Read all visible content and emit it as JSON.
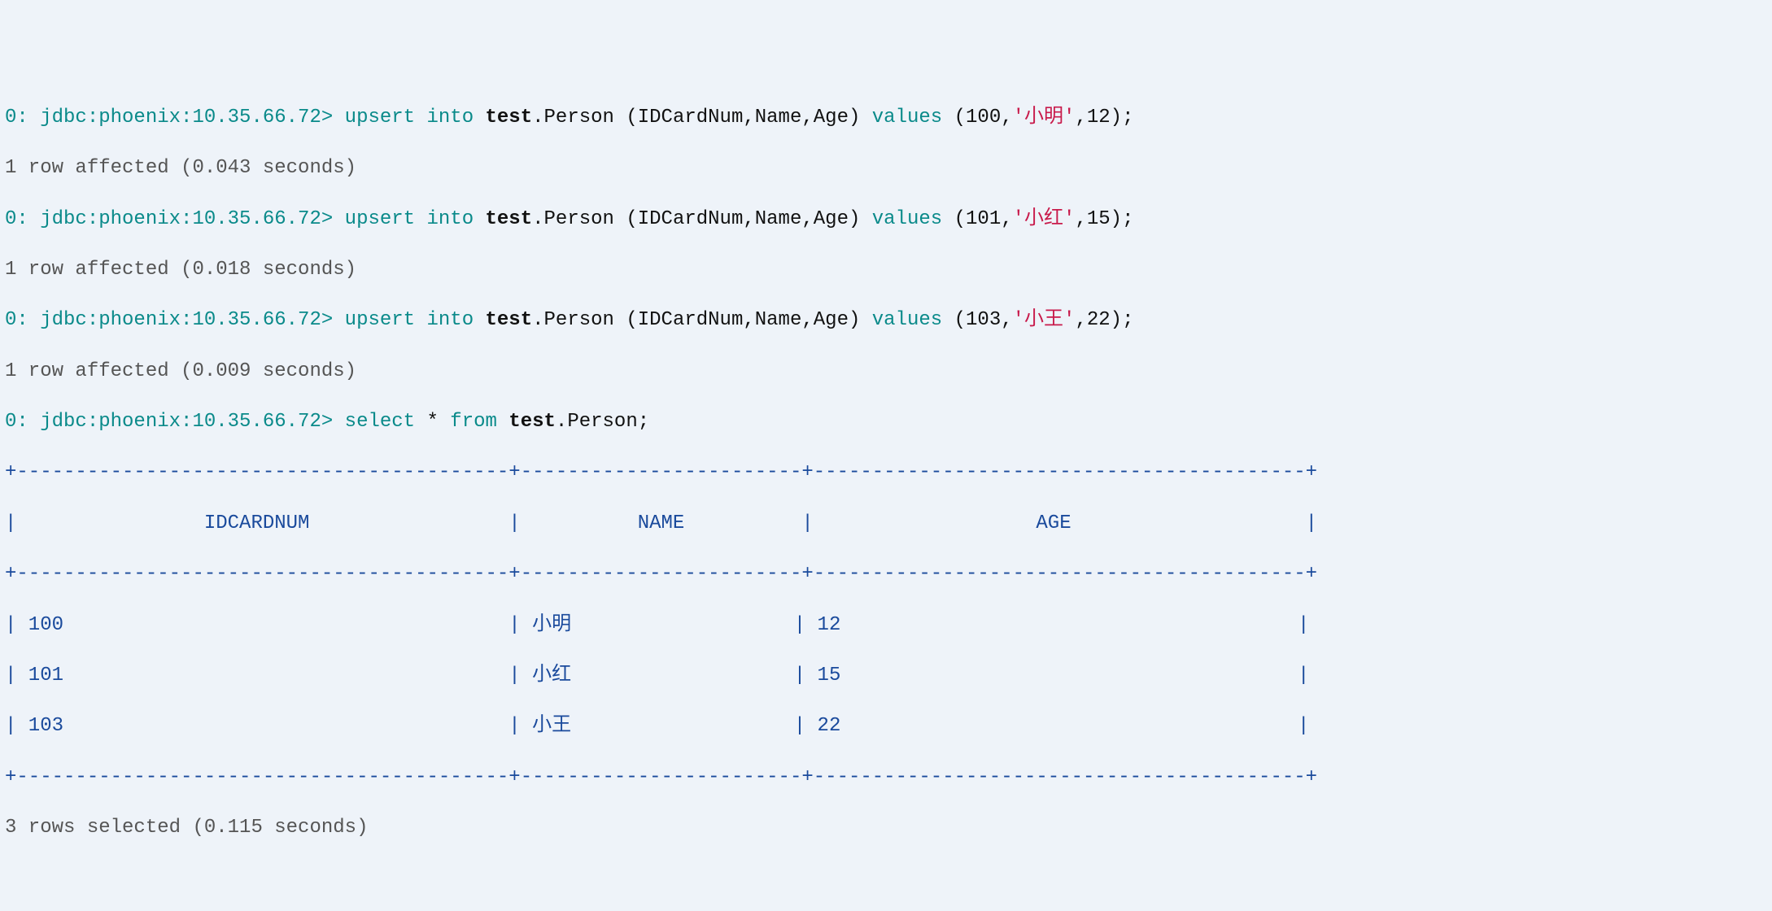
{
  "prompt": "0: jdbc:phoenix:10.35.66.72>",
  "upsert_kw": " upsert into ",
  "test_bold": "test",
  "person_tail1": ".Person (IDCardNum,Name,Age) ",
  "values_kw": "values",
  "paren_open": " (",
  "comma": ",",
  "close_paren_semi": ");",
  "affected1": "1 row affected (0.043 seconds)",
  "affected2": "1 row affected (0.018 seconds)",
  "affected3": "1 row affected (0.009 seconds)",
  "select_kw": " select ",
  "star": "*",
  "from_kw": " from ",
  "select_tail": ".Person;",
  "row1": {
    "id": "100",
    "name": "'小明'",
    "age": "12"
  },
  "row2": {
    "id": "101",
    "name": "'小红'",
    "age": "15"
  },
  "row3": {
    "id": "103",
    "name": "'小王'",
    "age": "22"
  },
  "values_tail1": ",12",
  "values_tail2": ",15",
  "values_tail3": ",22",
  "table": {
    "border": "+------------------------------------------+------------------------+------------------------------------------+",
    "header": "|                IDCARDNUM                 |          NAME          |                   AGE                    |",
    "r1": "| 100                                      | 小明                   | 12                                       |",
    "r2": "| 101                                      | 小红                   | 15                                       |",
    "r3": "| 103                                      | 小王                   | 22                                       |"
  },
  "footer": "3 rows selected (0.115 seconds)",
  "chart_data": {
    "type": "table",
    "columns": [
      "IDCARDNUM",
      "NAME",
      "AGE"
    ],
    "rows": [
      {
        "IDCARDNUM": 100,
        "NAME": "小明",
        "AGE": 12
      },
      {
        "IDCARDNUM": 101,
        "NAME": "小红",
        "AGE": 15
      },
      {
        "IDCARDNUM": 103,
        "NAME": "小王",
        "AGE": 22
      }
    ]
  }
}
